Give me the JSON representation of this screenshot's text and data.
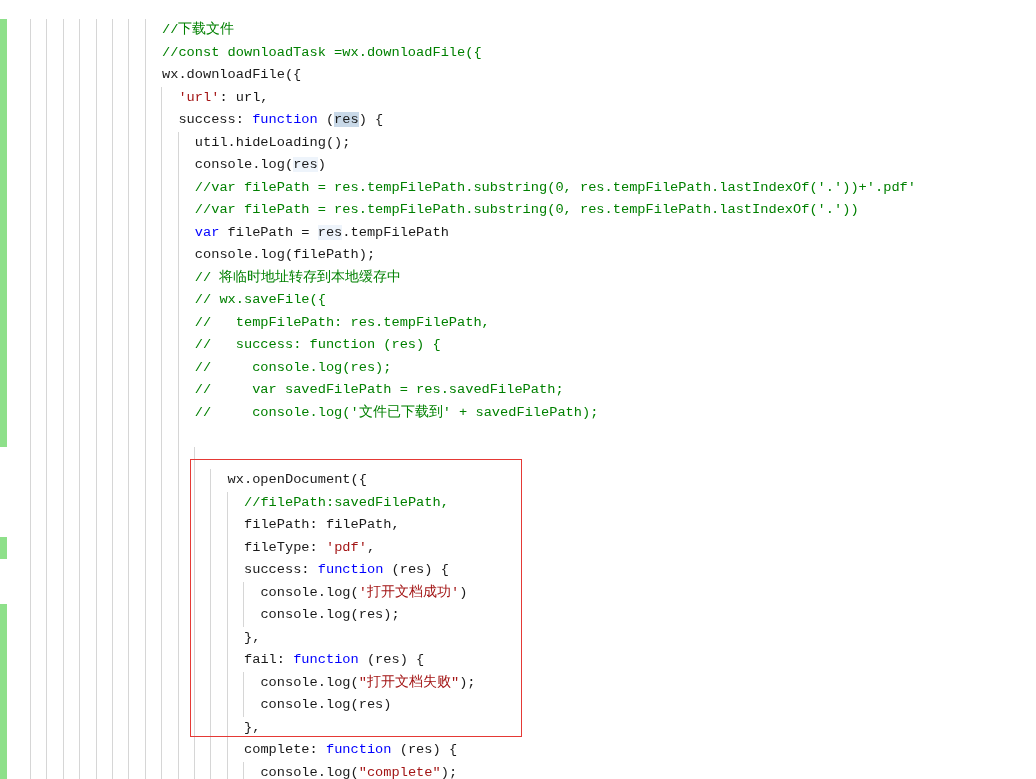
{
  "editor": {
    "lines": [
      {
        "changed": true,
        "tokens": [
          {
            "kind": "comment",
            "text": "//下载文件"
          }
        ]
      },
      {
        "changed": true,
        "tokens": [
          {
            "kind": "comment",
            "text": "//const downloadTask =wx.downloadFile({"
          }
        ]
      },
      {
        "changed": true,
        "tokens": [
          {
            "kind": "plain",
            "text": "wx.downloadFile({"
          }
        ],
        "children": [
          {
            "changed": true,
            "tokens": [
              {
                "kind": "string",
                "text": "'url'"
              },
              {
                "kind": "plain",
                "text": ": url,"
              }
            ]
          },
          {
            "changed": true,
            "tokens": [
              {
                "kind": "plain",
                "text": "success: "
              },
              {
                "kind": "keyword",
                "text": "function"
              },
              {
                "kind": "plain",
                "text": " ("
              },
              {
                "kind": "selection",
                "text": "res"
              },
              {
                "kind": "plain",
                "text": ") {"
              }
            ],
            "children": [
              {
                "changed": true,
                "tokens": [
                  {
                    "kind": "plain",
                    "text": "util.hideLoading();"
                  }
                ]
              },
              {
                "changed": true,
                "tokens": [
                  {
                    "kind": "plain",
                    "text": "console.log("
                  },
                  {
                    "kind": "occurrence",
                    "text": "res"
                  },
                  {
                    "kind": "plain",
                    "text": ")"
                  }
                ]
              },
              {
                "changed": true,
                "tokens": [
                  {
                    "kind": "comment",
                    "text": "//var filePath = res.tempFilePath.substring(0, res.tempFilePath.lastIndexOf('.'))+'.pdf'"
                  }
                ]
              },
              {
                "changed": true,
                "tokens": [
                  {
                    "kind": "comment",
                    "text": "//var filePath = res.tempFilePath.substring(0, res.tempFilePath.lastIndexOf('.'))"
                  }
                ]
              },
              {
                "changed": true,
                "tokens": [
                  {
                    "kind": "keyword",
                    "text": "var"
                  },
                  {
                    "kind": "plain",
                    "text": " filePath = "
                  },
                  {
                    "kind": "occurrence",
                    "text": "res"
                  },
                  {
                    "kind": "plain",
                    "text": ".tempFilePath"
                  }
                ]
              },
              {
                "changed": true,
                "tokens": [
                  {
                    "kind": "plain",
                    "text": "console.log(filePath);"
                  }
                ]
              },
              {
                "changed": true,
                "tokens": [
                  {
                    "kind": "comment",
                    "text": "// 将临时地址转存到本地缓存中"
                  }
                ]
              },
              {
                "changed": true,
                "tokens": [
                  {
                    "kind": "comment",
                    "text": "// wx.saveFile({"
                  }
                ]
              },
              {
                "changed": true,
                "tokens": [
                  {
                    "kind": "comment",
                    "text": "//   tempFilePath: res.tempFilePath,"
                  }
                ]
              },
              {
                "changed": true,
                "tokens": [
                  {
                    "kind": "comment",
                    "text": "//   success: function (res) {"
                  }
                ]
              },
              {
                "changed": true,
                "tokens": [
                  {
                    "kind": "comment",
                    "text": "//     console.log(res);"
                  }
                ]
              },
              {
                "changed": true,
                "tokens": [
                  {
                    "kind": "comment",
                    "text": "//     var savedFilePath = res.savedFilePath;"
                  }
                ]
              },
              {
                "changed": true,
                "tokens": [
                  {
                    "kind": "comment",
                    "text": "//     console.log('文件已下载到' + savedFilePath);"
                  }
                ]
              },
              {
                "changed": true,
                "children": [
                  {
                    "changed": false,
                    "children": [
                      {
                        "changed": false,
                        "tokens": [
                          {
                            "kind": "plain",
                            "text": "wx.openDocument({"
                          }
                        ],
                        "children": [
                          {
                            "changed": false,
                            "tokens": [
                              {
                                "kind": "comment",
                                "text": "//filePath:savedFilePath,"
                              }
                            ]
                          },
                          {
                            "changed": false,
                            "tokens": [
                              {
                                "kind": "plain",
                                "text": "filePath: filePath,"
                              }
                            ]
                          },
                          {
                            "changed": true,
                            "tokens": [
                              {
                                "kind": "plain",
                                "text": "fileType: "
                              },
                              {
                                "kind": "string",
                                "text": "'pdf'"
                              },
                              {
                                "kind": "plain",
                                "text": ","
                              }
                            ]
                          },
                          {
                            "changed": false,
                            "tokens": [
                              {
                                "kind": "plain",
                                "text": "success: "
                              },
                              {
                                "kind": "keyword",
                                "text": "function"
                              },
                              {
                                "kind": "plain",
                                "text": " (res) {"
                              }
                            ],
                            "children": [
                              {
                                "changed": false,
                                "tokens": [
                                  {
                                    "kind": "plain",
                                    "text": "console.log("
                                  },
                                  {
                                    "kind": "string",
                                    "text": "'打开文档成功'"
                                  },
                                  {
                                    "kind": "plain",
                                    "text": ")"
                                  }
                                ]
                              },
                              {
                                "changed": true,
                                "tokens": [
                                  {
                                    "kind": "plain",
                                    "text": "console.log(res);"
                                  }
                                ]
                              }
                            ]
                          },
                          {
                            "changed": true,
                            "tokens": [
                              {
                                "kind": "plain",
                                "text": "},"
                              }
                            ]
                          },
                          {
                            "changed": true,
                            "tokens": [
                              {
                                "kind": "plain",
                                "text": "fail: "
                              },
                              {
                                "kind": "keyword",
                                "text": "function"
                              },
                              {
                                "kind": "plain",
                                "text": " (res) {"
                              }
                            ],
                            "children": [
                              {
                                "changed": true,
                                "tokens": [
                                  {
                                    "kind": "plain",
                                    "text": "console.log("
                                  },
                                  {
                                    "kind": "string",
                                    "text": "\"打开文档失败\""
                                  },
                                  {
                                    "kind": "plain",
                                    "text": ");"
                                  }
                                ]
                              },
                              {
                                "changed": true,
                                "tokens": [
                                  {
                                    "kind": "plain",
                                    "text": "console.log(res)"
                                  }
                                ]
                              }
                            ]
                          },
                          {
                            "changed": true,
                            "tokens": [
                              {
                                "kind": "plain",
                                "text": "},"
                              }
                            ]
                          },
                          {
                            "changed": true,
                            "tokens": [
                              {
                                "kind": "plain",
                                "text": "complete: "
                              },
                              {
                                "kind": "keyword",
                                "text": "function"
                              },
                              {
                                "kind": "plain",
                                "text": " (res) {"
                              }
                            ],
                            "children": [
                              {
                                "changed": true,
                                "tokens": [
                                  {
                                    "kind": "plain",
                                    "text": "console.log("
                                  },
                                  {
                                    "kind": "string",
                                    "text": "\"complete\""
                                  },
                                  {
                                    "kind": "plain",
                                    "text": ");"
                                  }
                                ]
                              }
                            ]
                          }
                        ]
                      }
                    ]
                  }
                ]
              }
            ]
          }
        ]
      }
    ]
  }
}
